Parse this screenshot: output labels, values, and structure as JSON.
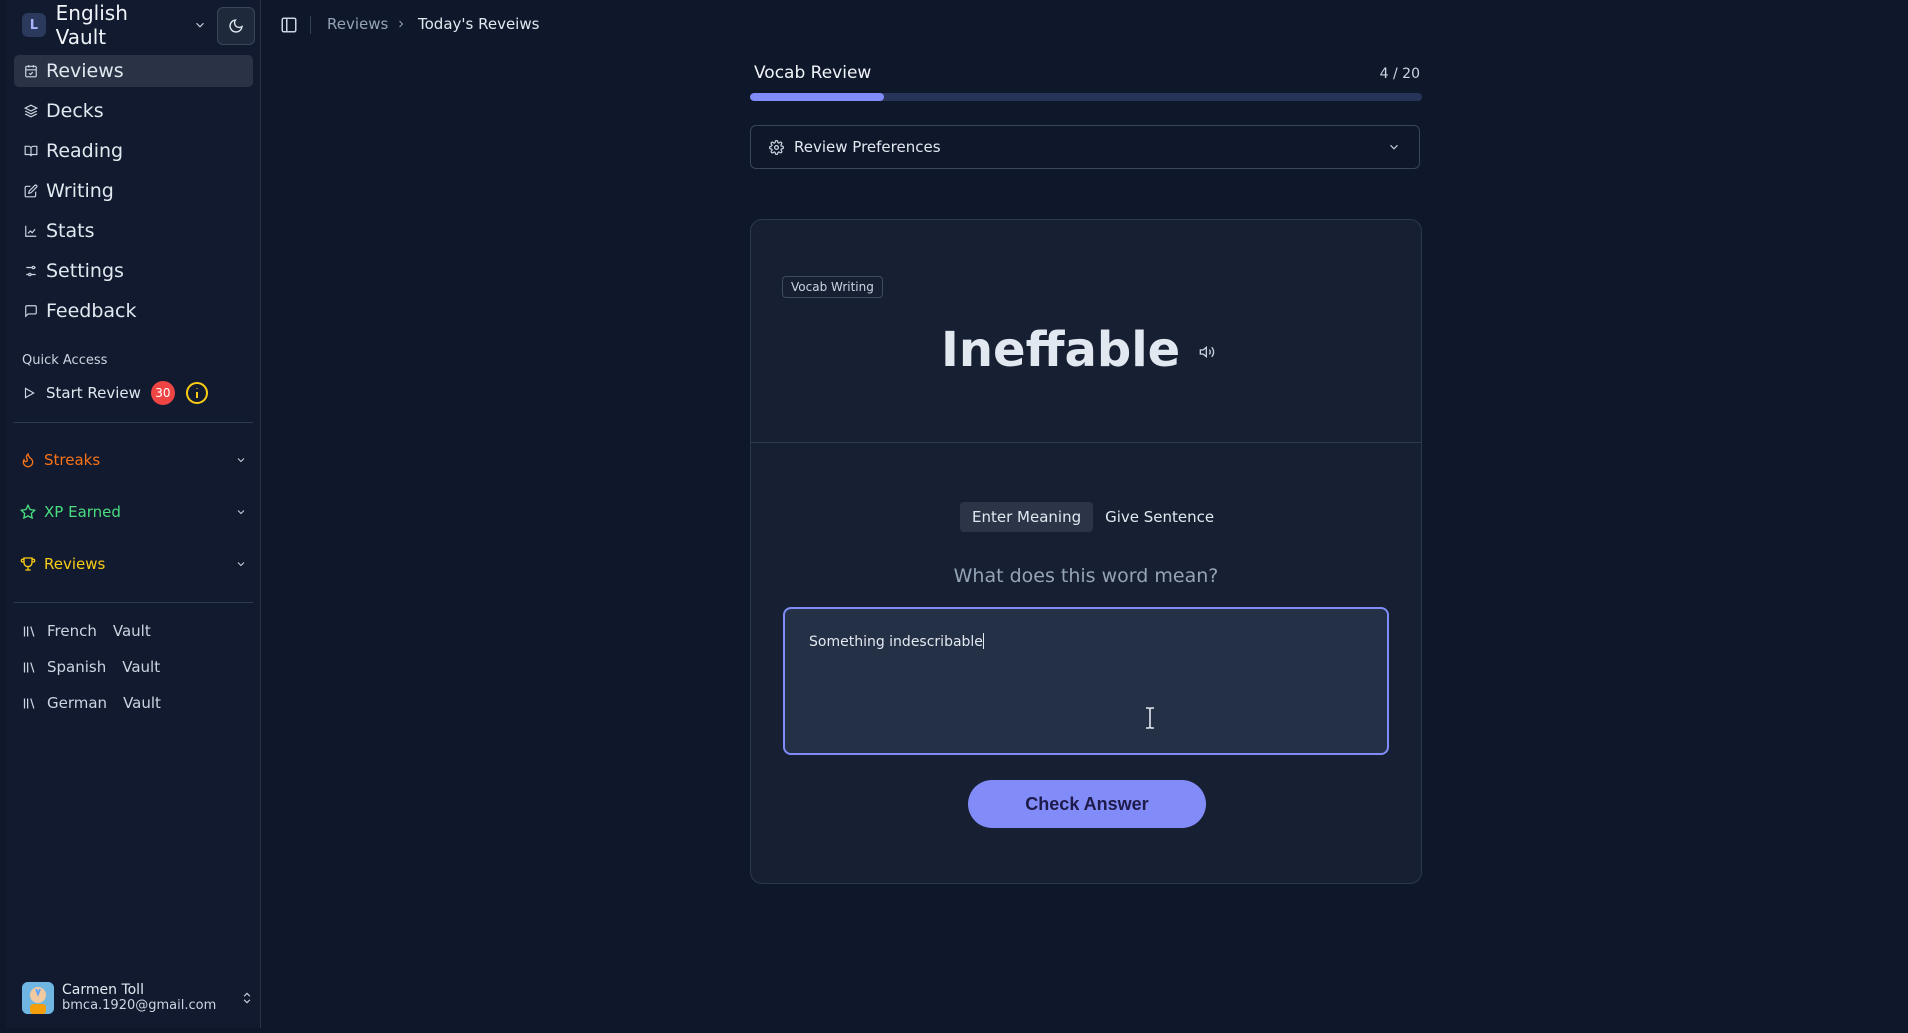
{
  "workspace": {
    "initial": "L",
    "name": "English Vault"
  },
  "nav": [
    {
      "label": "Reviews",
      "icon": "calendar-check-icon",
      "active": true
    },
    {
      "label": "Decks",
      "icon": "layers-icon"
    },
    {
      "label": "Reading",
      "icon": "book-open-icon"
    },
    {
      "label": "Writing",
      "icon": "pencil-square-icon"
    },
    {
      "label": "Stats",
      "icon": "chart-line-icon"
    },
    {
      "label": "Settings",
      "icon": "sliders-icon"
    },
    {
      "label": "Feedback",
      "icon": "message-square-icon"
    }
  ],
  "quick_access": {
    "label": "Quick Access",
    "start_review": {
      "label": "Start Review",
      "badge": "30"
    }
  },
  "stats": [
    {
      "label": "Streaks",
      "icon": "flame-icon",
      "color": "#f97316"
    },
    {
      "label": "XP Earned",
      "icon": "star-icon",
      "color": "#4ade80"
    },
    {
      "label": "Reviews",
      "icon": "trophy-icon",
      "color": "#facc15"
    }
  ],
  "vaults": [
    {
      "name": "French",
      "suffix": "Vault"
    },
    {
      "name": "Spanish",
      "suffix": "Vault"
    },
    {
      "name": "German",
      "suffix": "Vault"
    }
  ],
  "user": {
    "name": "Carmen Toll",
    "email": "bmca.1920@gmail.com"
  },
  "breadcrumb": {
    "parent": "Reviews",
    "current": "Today's Reveiws"
  },
  "review": {
    "title": "Vocab Review",
    "count": "4 / 20",
    "progress": 0.2,
    "preferences_label": "Review Preferences",
    "tag": "Vocab Writing",
    "word": "Ineffable",
    "tabs": [
      {
        "label": "Enter Meaning",
        "active": true
      },
      {
        "label": "Give Sentence",
        "active": false
      }
    ],
    "question": "What does this word mean?",
    "answer": "Something indescribable",
    "check_label": "Check Answer"
  },
  "colors": {
    "accent": "#818cf8",
    "badge": "#ef4444",
    "info": "#facc15"
  }
}
